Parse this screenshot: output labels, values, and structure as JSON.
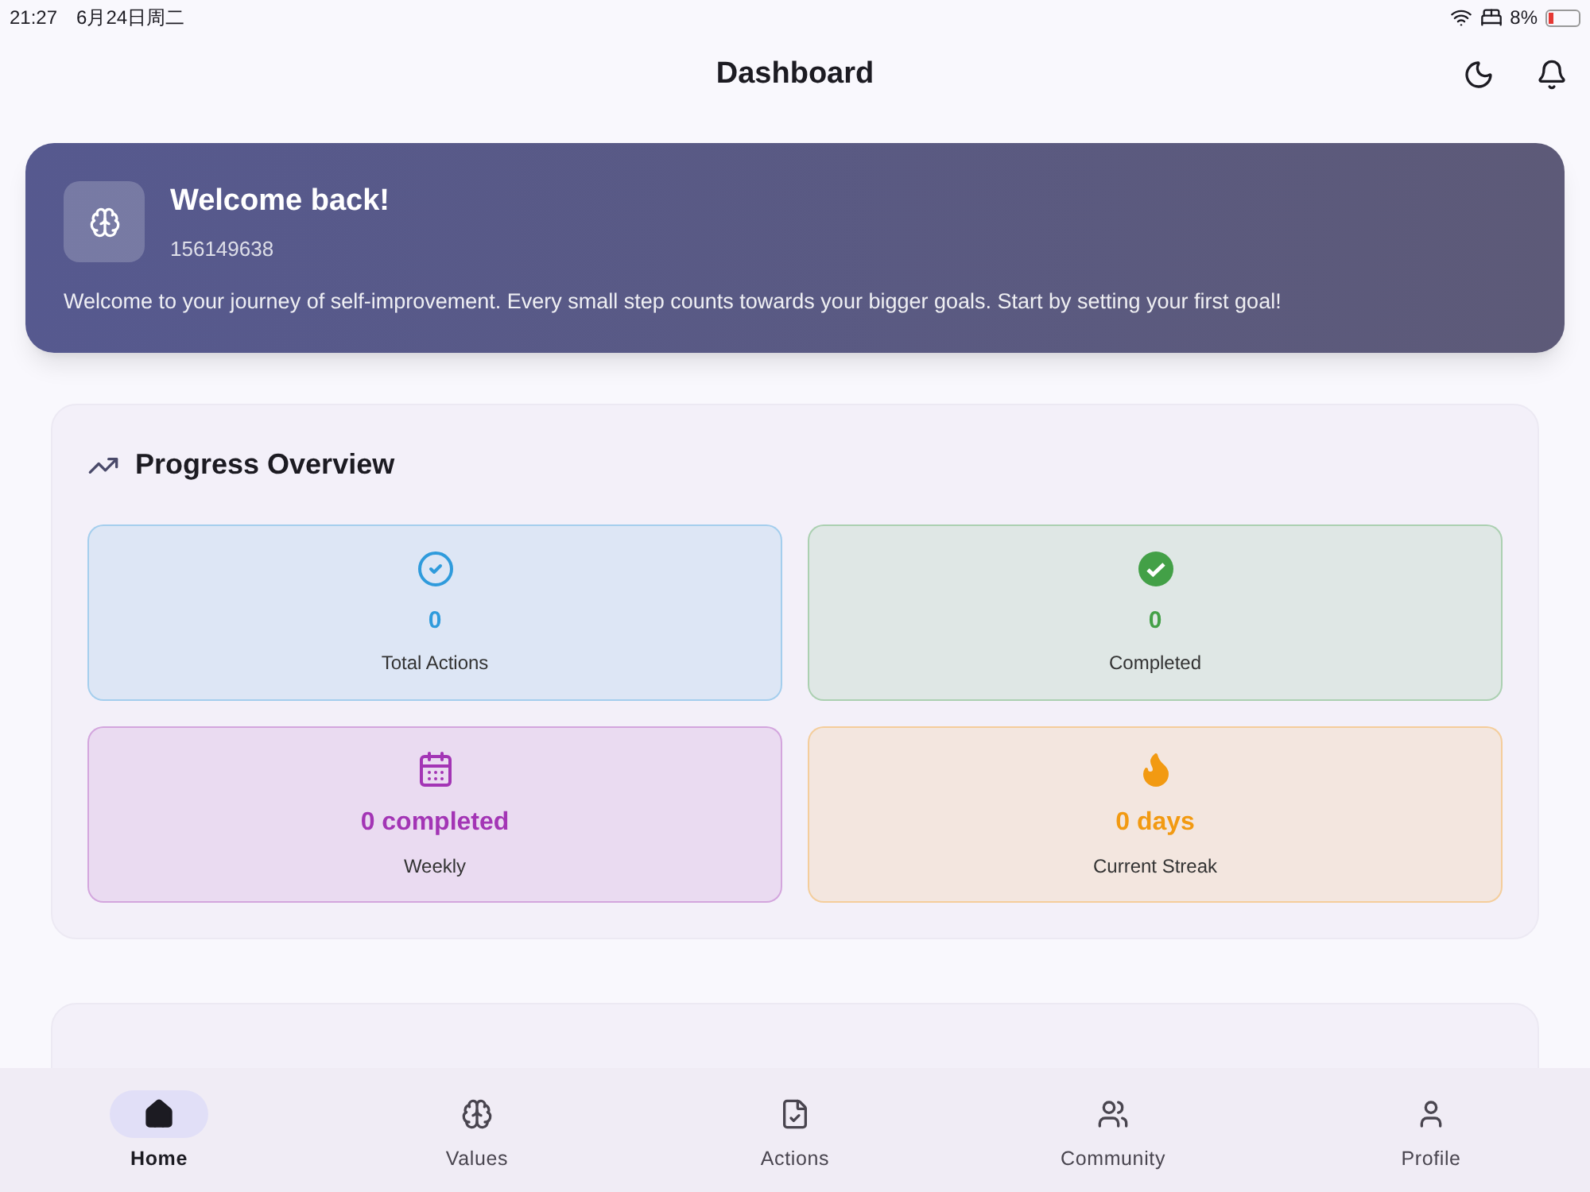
{
  "status_bar": {
    "time": "21:27",
    "date": "6月24日周二",
    "battery": "8%"
  },
  "header": {
    "title": "Dashboard"
  },
  "welcome": {
    "title": "Welcome back!",
    "user_id": "156149638",
    "message": "Welcome to your journey of self-improvement. Every small step counts towards your bigger goals. Start by setting your first goal!"
  },
  "progress": {
    "title": "Progress Overview",
    "stats": [
      {
        "kind": "total",
        "value": "0",
        "label": "Total Actions",
        "color": "#2f9bdc"
      },
      {
        "kind": "completed",
        "value": "0",
        "label": "Completed",
        "color": "#43a047"
      },
      {
        "kind": "weekly",
        "value": "0 completed",
        "label": "Weekly",
        "color": "#a335b5"
      },
      {
        "kind": "streak",
        "value": "0 days",
        "label": "Current Streak",
        "color": "#f29a12"
      }
    ]
  },
  "nav": [
    {
      "kind": "home",
      "label": "Home",
      "selected": true
    },
    {
      "kind": "values",
      "label": "Values",
      "selected": false
    },
    {
      "kind": "actions",
      "label": "Actions",
      "selected": false
    },
    {
      "kind": "community",
      "label": "Community",
      "selected": false
    },
    {
      "kind": "profile",
      "label": "Profile",
      "selected": false
    }
  ]
}
